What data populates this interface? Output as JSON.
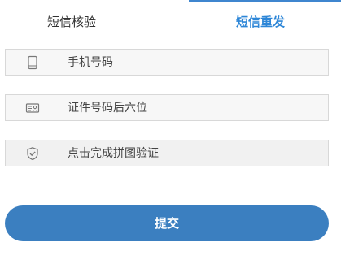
{
  "tabs": {
    "sms_verify": "短信核验",
    "sms_resend": "短信重发"
  },
  "form": {
    "phone_placeholder": "手机号码",
    "id_last6_placeholder": "证件号码后六位",
    "captcha_label": "点击完成拼图验证"
  },
  "actions": {
    "submit_label": "提交"
  },
  "icons": {
    "phone": "phone-icon",
    "id_card": "id-card-icon",
    "shield": "shield-check-icon"
  },
  "colors": {
    "accent": "#2d86d7",
    "button": "#3b7fc0"
  }
}
